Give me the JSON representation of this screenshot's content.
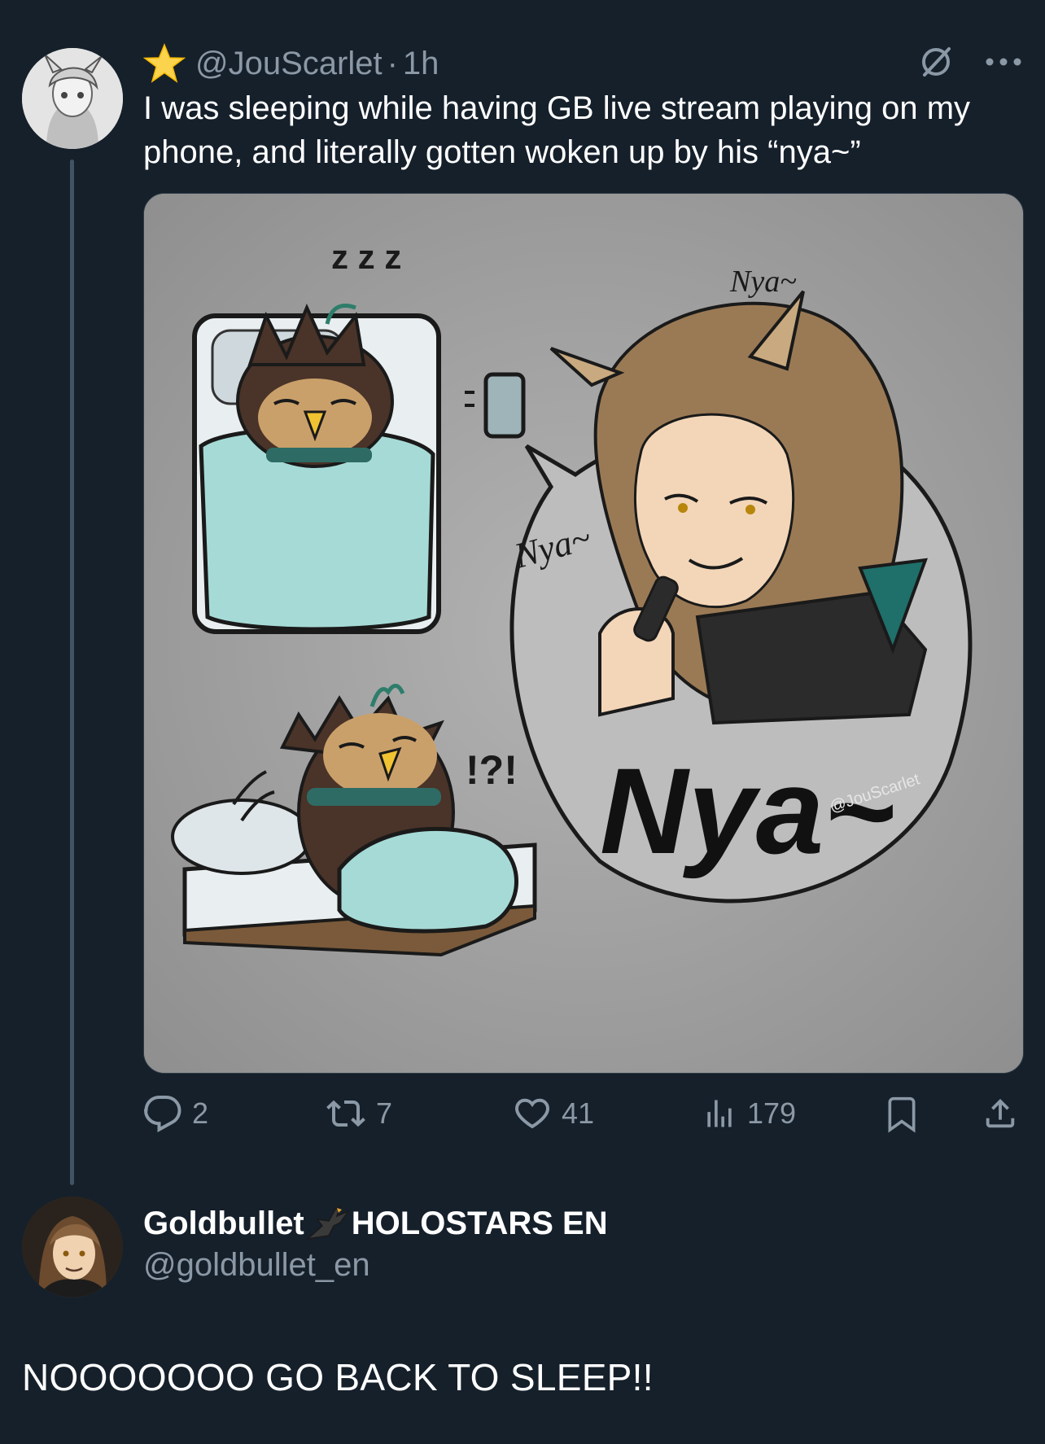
{
  "tweet": {
    "handle": "@JouScarlet",
    "separator": "·",
    "time": "1h",
    "text": "I was sleeping while having GB live stream playing on my phone, and literally gotten woken up by his “nya~”",
    "badge_icon": "star-icon",
    "image": {
      "zzz": "z z z",
      "marks": "!?!",
      "nya_small_1": "Nya~",
      "nya_small_2": "Nya~",
      "nya_big": "Nya~",
      "watermark": "@JouScarlet"
    },
    "stats": {
      "replies": "2",
      "reposts": "7",
      "likes": "41",
      "views": "179"
    }
  },
  "reply": {
    "name_part1": "Goldbullet",
    "name_part2": "HOLOSTARS EN",
    "handle": "@goldbullet_en",
    "text": "NOOOOOOO GO BACK TO SLEEP!!"
  },
  "colors": {
    "background": "#15202b",
    "text_primary": "#ffffff",
    "text_secondary": "#8b98a5",
    "media_bg": "#999999",
    "blanket": "#a6dad6",
    "owl_brown": "#4a3328"
  }
}
